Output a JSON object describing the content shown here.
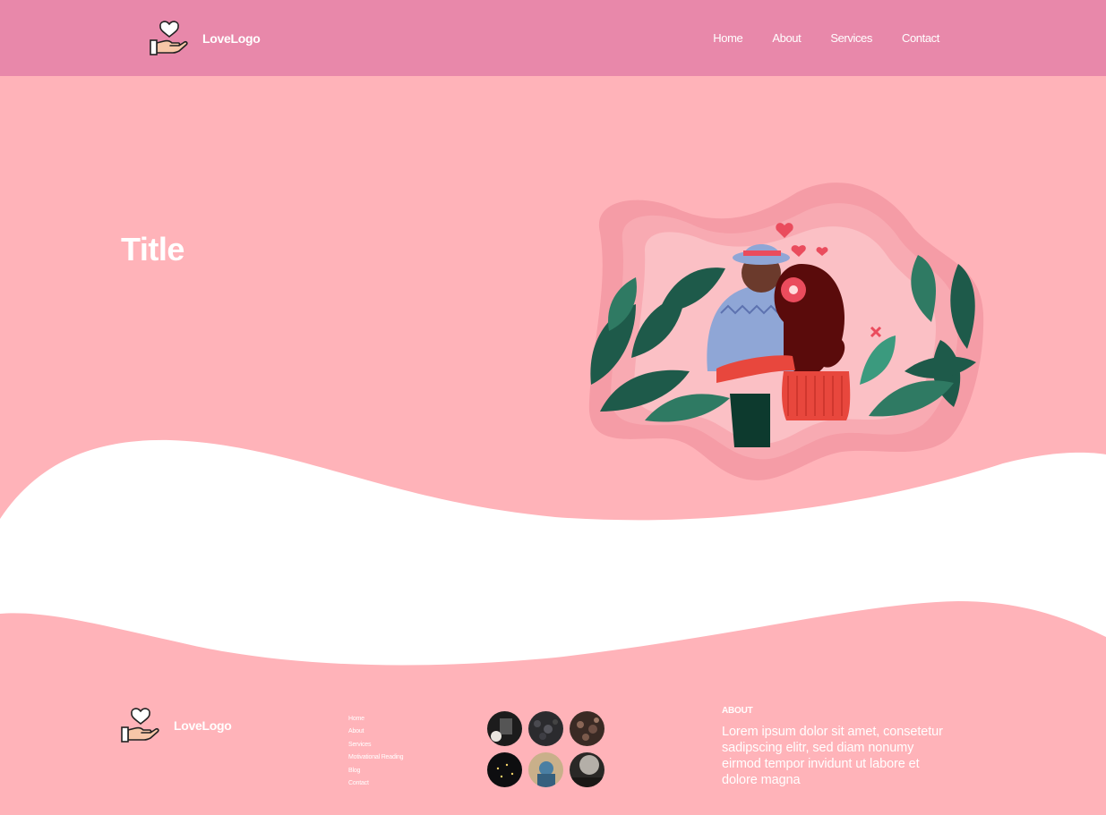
{
  "header": {
    "logo_text": "LoveLogo",
    "logo_icon": "heart-hand-icon",
    "nav": [
      "Home",
      "About",
      "Services",
      "Contact"
    ]
  },
  "hero": {
    "title": "Title",
    "illustration": "couple-hugging-illustration"
  },
  "footer": {
    "logo_text": "LoveLogo",
    "links": [
      "Home",
      "About",
      "Services",
      "Motivational Reading",
      "Blog",
      "Contact"
    ],
    "gallery": [
      "concert-photo-1",
      "concert-photo-2",
      "concert-photo-3",
      "concert-photo-4",
      "concert-photo-5",
      "concert-photo-6"
    ],
    "about_title": "ABOUT",
    "about_text": "Lorem ipsum dolor sit amet, consetetur sadipscing elitr, sed diam nonumy eirmod tempor invidunt ut labore et dolore magna"
  },
  "colors": {
    "header_bg": "#e888aa",
    "hero_bg": "#ffb3b9",
    "accent_red": "#ea4c5d",
    "leaf_green": "#1e5a4a"
  }
}
